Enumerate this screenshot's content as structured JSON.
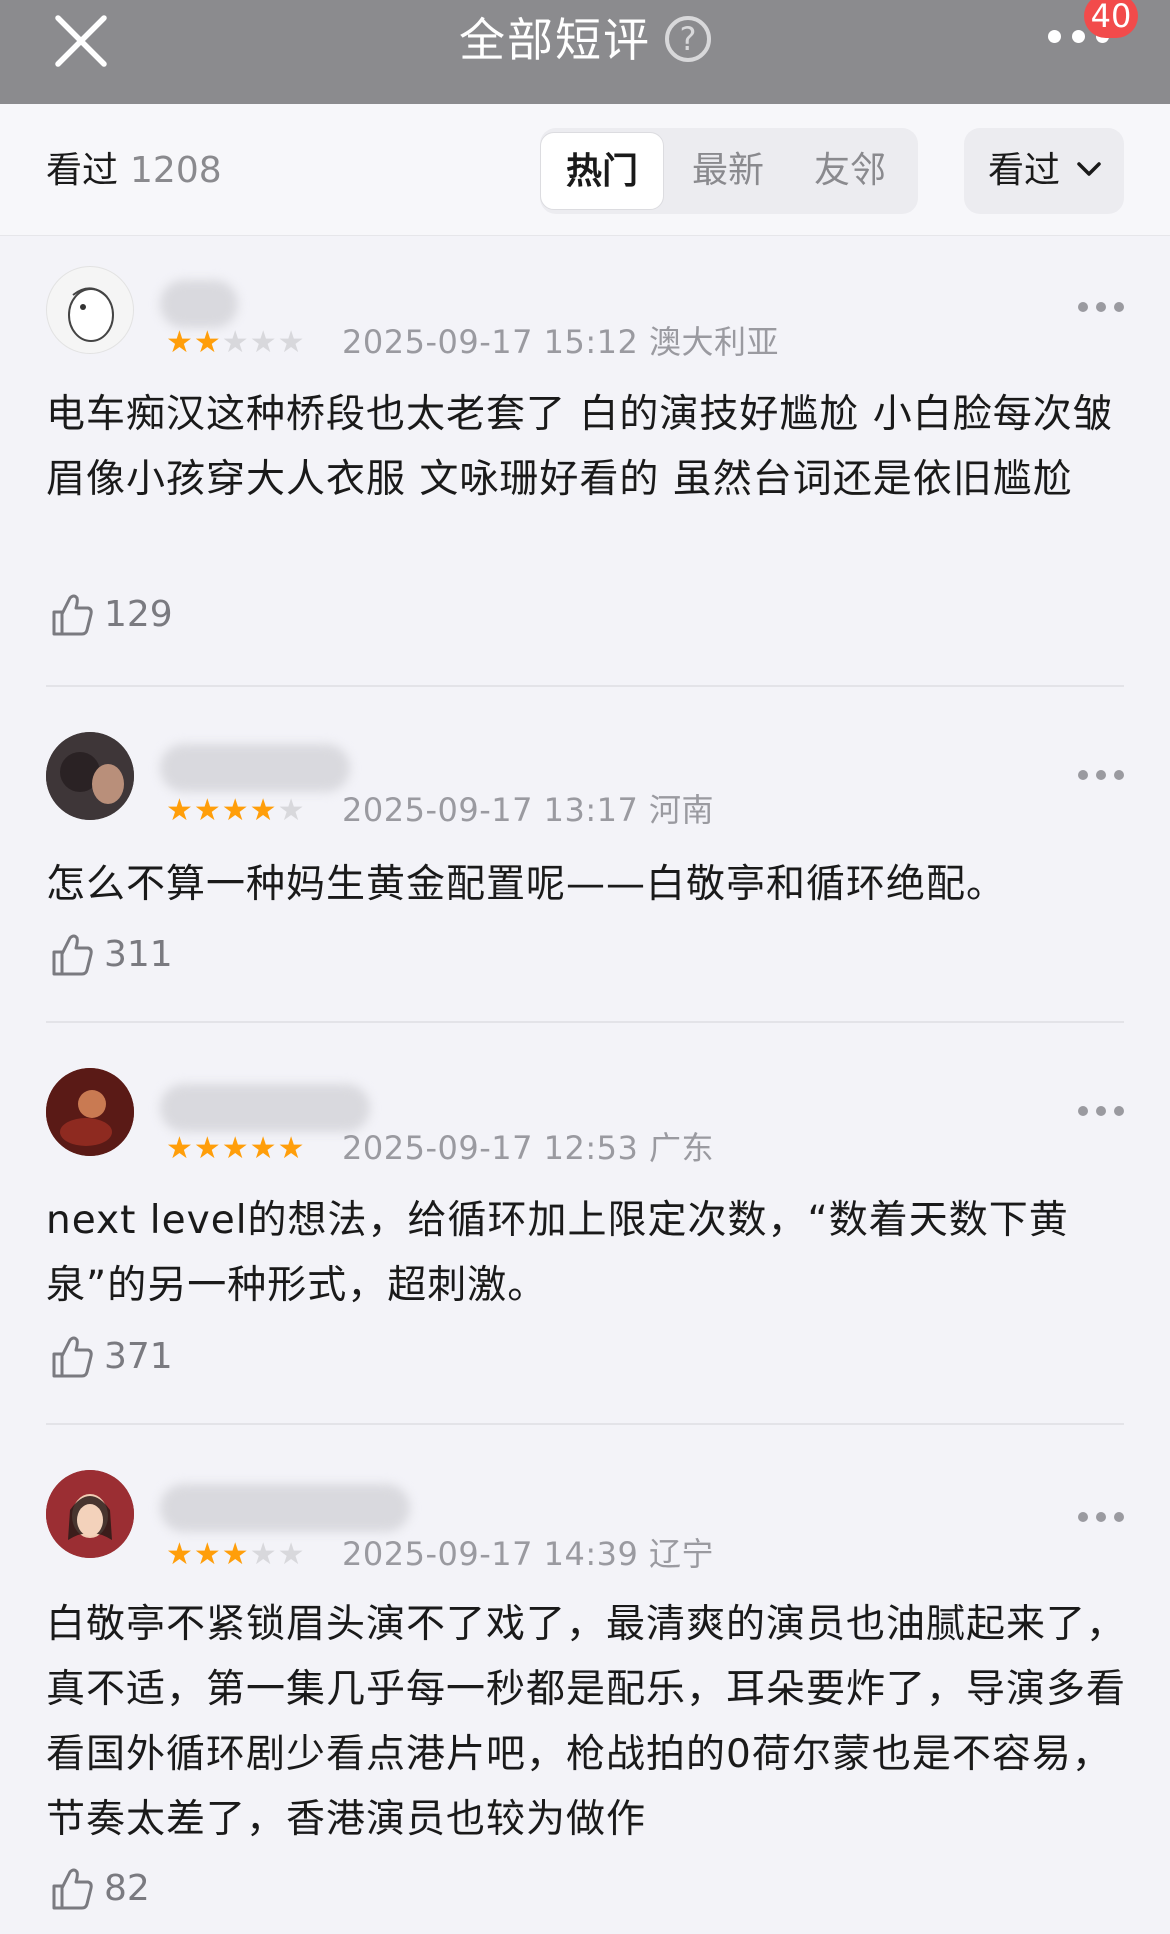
{
  "header": {
    "title": "全部短评",
    "help_glyph": "?",
    "notification_count": "40"
  },
  "filter": {
    "count_label": "看过",
    "count_value": "1208",
    "tabs": [
      {
        "label": "热门",
        "active": true
      },
      {
        "label": "最新",
        "active": false
      },
      {
        "label": "友邻",
        "active": false
      }
    ],
    "status_select": "看过"
  },
  "reviews": [
    {
      "rating": 2,
      "time": "2025-09-17 15:12",
      "location": "澳大利亚",
      "text": "电车痴汉这种桥段也太老套了 白的演技好尴尬 小白脸每次皱眉像小孩穿大人衣服 文咏珊好看的 虽然台词还是依旧尴尬",
      "likes": "129"
    },
    {
      "rating": 4,
      "time": "2025-09-17 13:17",
      "location": "河南",
      "text": "怎么不算一种妈生黄金配置呢——白敬亭和循环绝配。",
      "likes": "311"
    },
    {
      "rating": 5,
      "time": "2025-09-17 12:53",
      "location": "广东",
      "text": "next level的想法，给循环加上限定次数，“数着天数下黄泉”的另一种形式，超刺激。",
      "likes": "371"
    },
    {
      "rating": 3,
      "time": "2025-09-17 14:39",
      "location": "辽宁",
      "text": "白敬亭不紧锁眉头演不了戏了，最清爽的演员也油腻起来了，真不适，第一集几乎每一秒都是配乐，耳朵要炸了，导演多看看国外循环剧少看点港片吧，枪战拍的0荷尔蒙也是不容易，节奏太差了，香港演员也较为做作",
      "likes": "82"
    }
  ],
  "colors": {
    "header_bg": "#8b8b8e",
    "star_on": "#ff9e0a",
    "star_off": "#d8d8dc",
    "badge": "#f24b4b",
    "muted_text": "#9a9aa0"
  },
  "icons": [
    "close-icon",
    "help-icon",
    "more-icon",
    "chevron-down-icon",
    "thumbs-up-icon"
  ]
}
